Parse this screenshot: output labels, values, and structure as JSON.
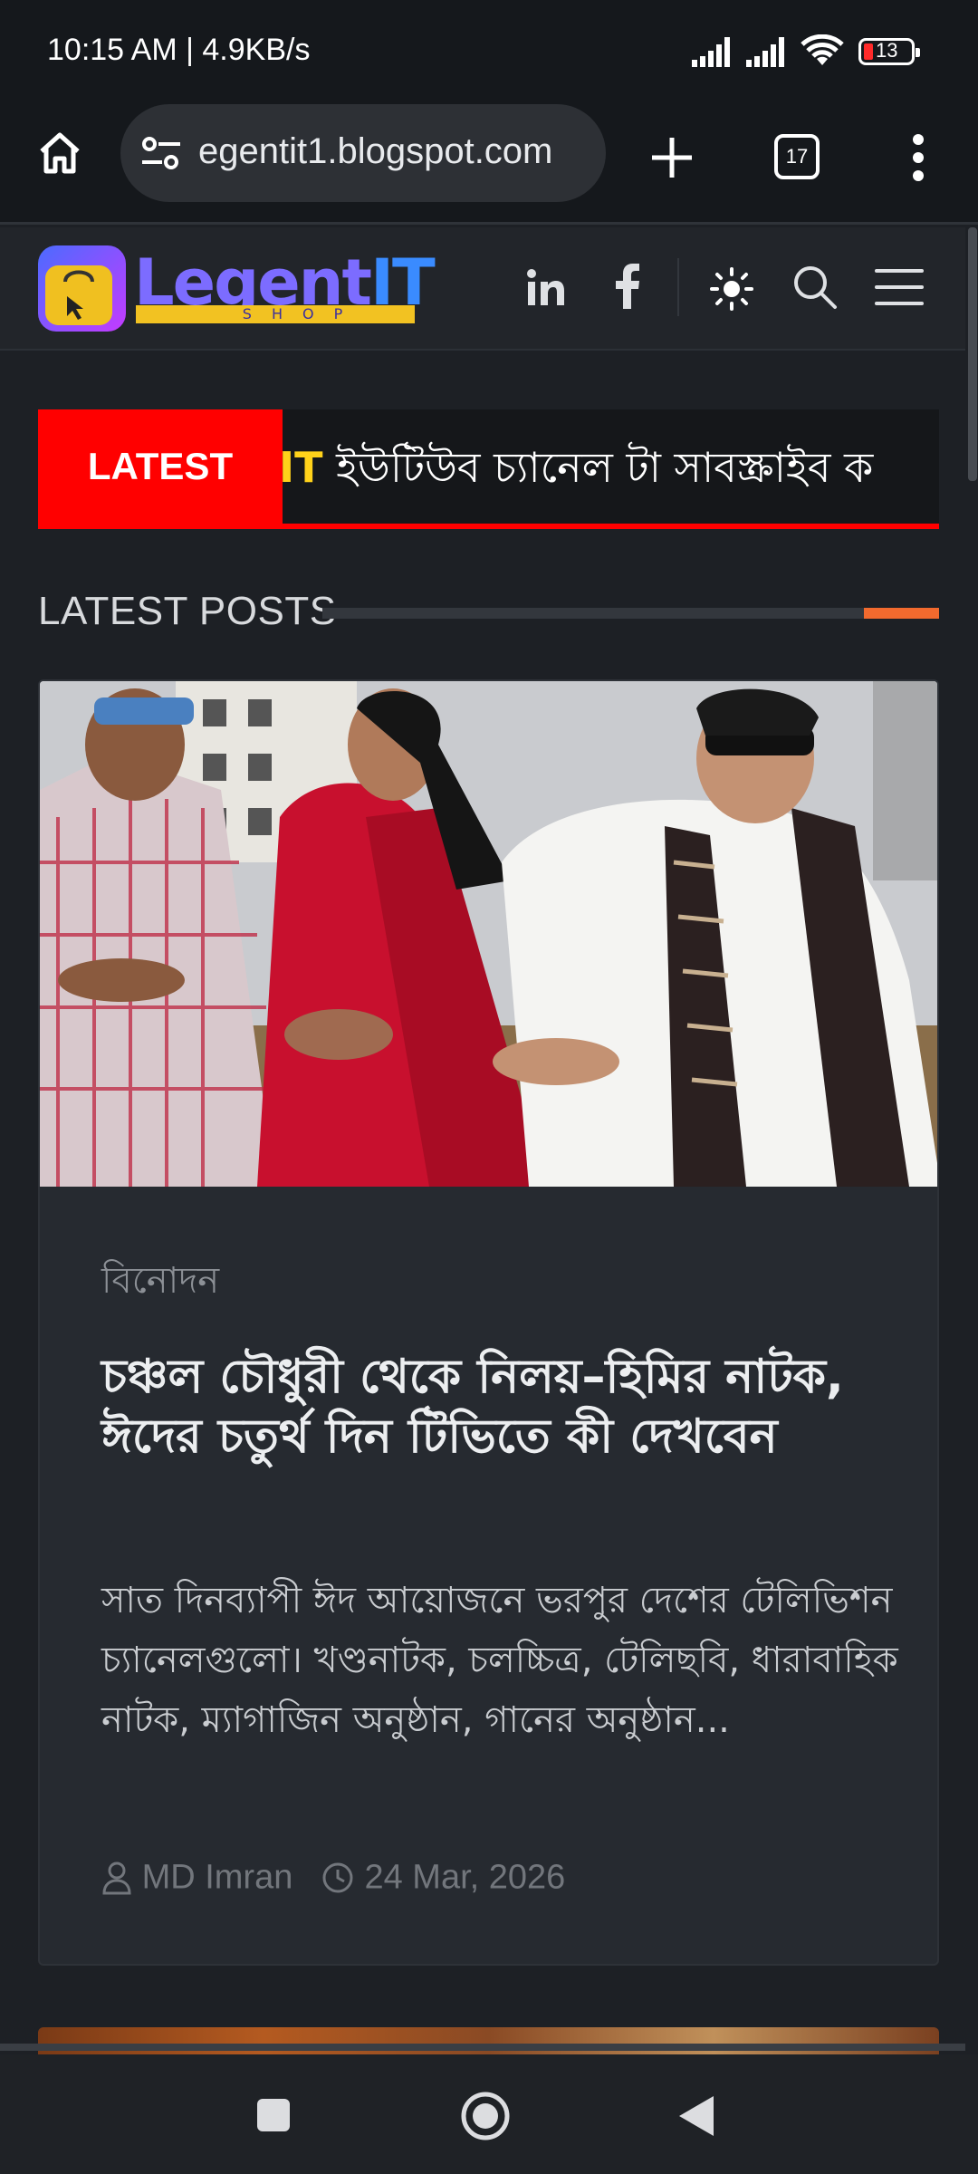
{
  "status_bar": {
    "time": "10:15 AM | 4.9KB/s",
    "battery": "13"
  },
  "browser": {
    "url": "egentit1.blogspot.com",
    "tab_count": "17"
  },
  "site": {
    "logo_text": "LegentIT",
    "logo_sub": "SHOP"
  },
  "ticker": {
    "label": "LATEST",
    "highlight": "IT",
    "text": " ইউটিউব চ্যানেল টা সাবস্ক্রাইব ক"
  },
  "section": {
    "title": "LATEST POSTS"
  },
  "post": {
    "category": "বিনোদন",
    "headline": "চঞ্চল চৌধুরী থেকে নিলয়–হিমির নাটক, ঈদের চতুর্থ দিন টিভিতে কী দেখবেন",
    "excerpt": "সাত দিনব্যাপী ঈদ আয়োজনে ভরপুর দেশের টেলিভিশন চ্যানেলগুলো। খণ্ডনাটক, চলচ্চিত্র, টেলিছবি, ধারাবাহিক নাটক, ম্যাগাজিন অনুষ্ঠান, গানের অনুষ্ঠান...",
    "author": "MD Imran",
    "date": "24 Mar, 2026"
  },
  "icons": {
    "home": "home-icon",
    "site_settings": "tune-icon",
    "new_tab": "plus-icon",
    "tabs": "tabs-icon",
    "menu": "more-vert-icon",
    "linkedin": "linkedin-icon",
    "facebook": "facebook-icon",
    "theme": "sun-icon",
    "search": "search-icon",
    "hamburger": "hamburger-icon",
    "author": "user-icon",
    "date": "clock-icon"
  },
  "colors": {
    "ticker_label_bg": "#ff0000",
    "section_accent": "#f26a2e",
    "page_bg": "#1d2025",
    "card_bg": "#262a30"
  }
}
